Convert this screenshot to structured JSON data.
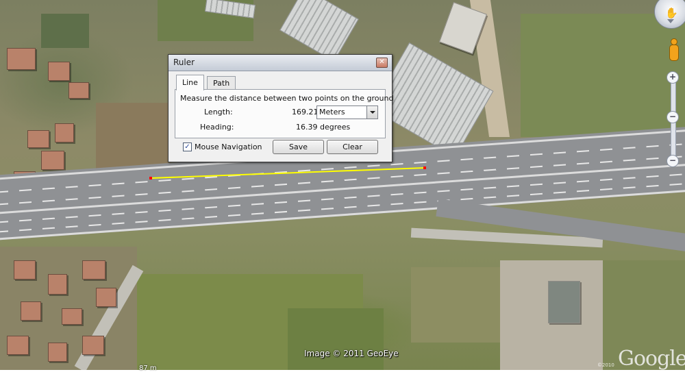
{
  "dialog": {
    "title": "Ruler",
    "tabs": [
      {
        "label": "Line",
        "active": true
      },
      {
        "label": "Path",
        "active": false
      }
    ],
    "description": "Measure the distance between two points on the ground",
    "length_label": "Length:",
    "length_value": "169.21",
    "unit": "Meters",
    "heading_label": "Heading:",
    "heading_value": "16.39 degrees",
    "mouse_navigation_label": "Mouse Navigation",
    "mouse_navigation_checked": true,
    "save_label": "Save",
    "clear_label": "Clear"
  },
  "map": {
    "attribution": "Image © 2011 GeoEye",
    "logo": "Google",
    "logo_year": "©2010",
    "scale_text": "87 m",
    "ruler_line_color": "#ffff00",
    "ruler_endpoint_color": "#ff0000"
  },
  "nav": {
    "zoom_in": "+",
    "zoom_out": "−",
    "zoom_minus_mid": "−"
  }
}
